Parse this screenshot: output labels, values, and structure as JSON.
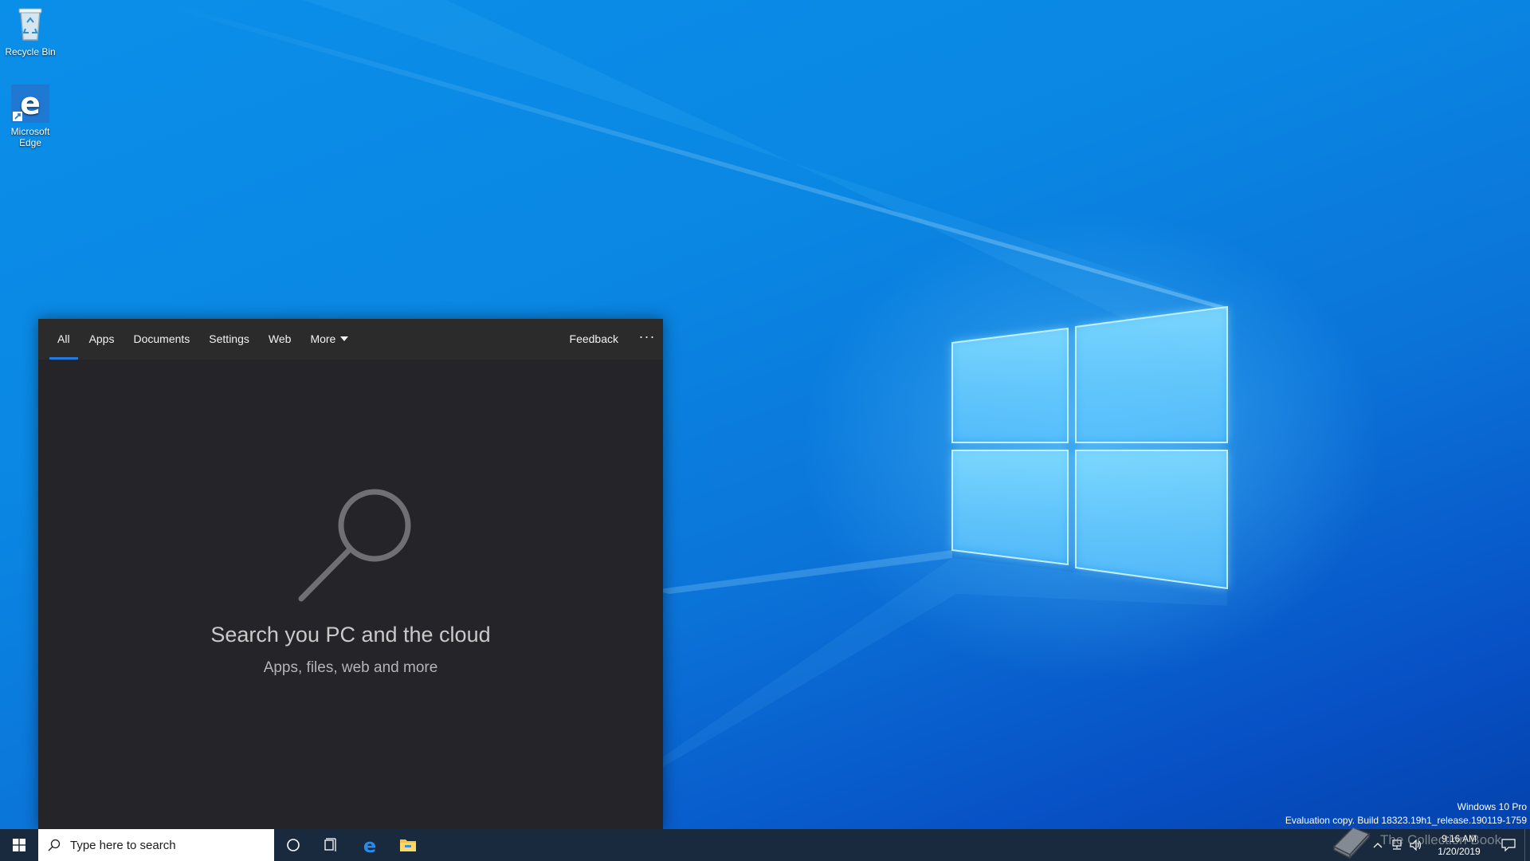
{
  "desktop": {
    "icons": [
      {
        "label": "Recycle Bin"
      },
      {
        "label": "Microsoft Edge"
      }
    ]
  },
  "search_panel": {
    "tabs": [
      {
        "label": "All",
        "active": true
      },
      {
        "label": "Apps"
      },
      {
        "label": "Documents"
      },
      {
        "label": "Settings"
      },
      {
        "label": "Web"
      },
      {
        "label": "More"
      }
    ],
    "feedback_label": "Feedback",
    "more_options_label": "···",
    "empty_title": "Search you PC and the cloud",
    "empty_subtitle": "Apps, files, web and more",
    "icon": "magnifier-icon"
  },
  "watermark": {
    "edition": "Windows 10 Pro",
    "build": "Evaluation copy. Build 18323.19h1_release.190119-1759"
  },
  "taskbar": {
    "search_placeholder": "Type here to search",
    "pinned": [
      "cortana-icon",
      "task-view-icon",
      "edge-icon",
      "file-explorer-icon"
    ],
    "clock_time": "9:16 AM",
    "clock_date": "1/20/2019",
    "tray_icons": [
      "chevron-up-icon",
      "network-icon",
      "volume-icon",
      "action-center-icon"
    ]
  },
  "brand": {
    "text": "The Collection Book"
  },
  "colors": {
    "accent": "#1e7ae0",
    "panel_bg": "#252529",
    "taskbar_bg": "#1a2a3e"
  }
}
